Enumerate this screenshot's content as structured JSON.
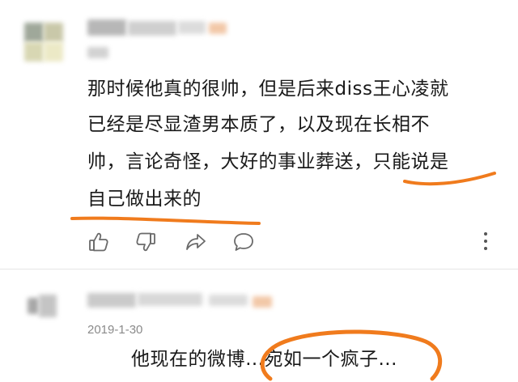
{
  "comment1": {
    "lines": [
      "那时候他真的很帅，但是后来diss王心凌就",
      "已经是尽显渣男本质了，以及现在长相不",
      "帅，言论奇怪，大好的事业葬送，只能说是",
      "自己做出来的"
    ]
  },
  "actions": {
    "like": "thumbs-up-icon",
    "dislike": "thumbs-down-icon",
    "share": "share-arrow-icon",
    "reply": "comment-bubble-icon",
    "more": "more-vertical-icon"
  },
  "comment2": {
    "date": "2019-1-30",
    "text": "他现在的微博…宛如一个疯子..."
  },
  "colors": {
    "accent_orange": "#f07b1d"
  }
}
